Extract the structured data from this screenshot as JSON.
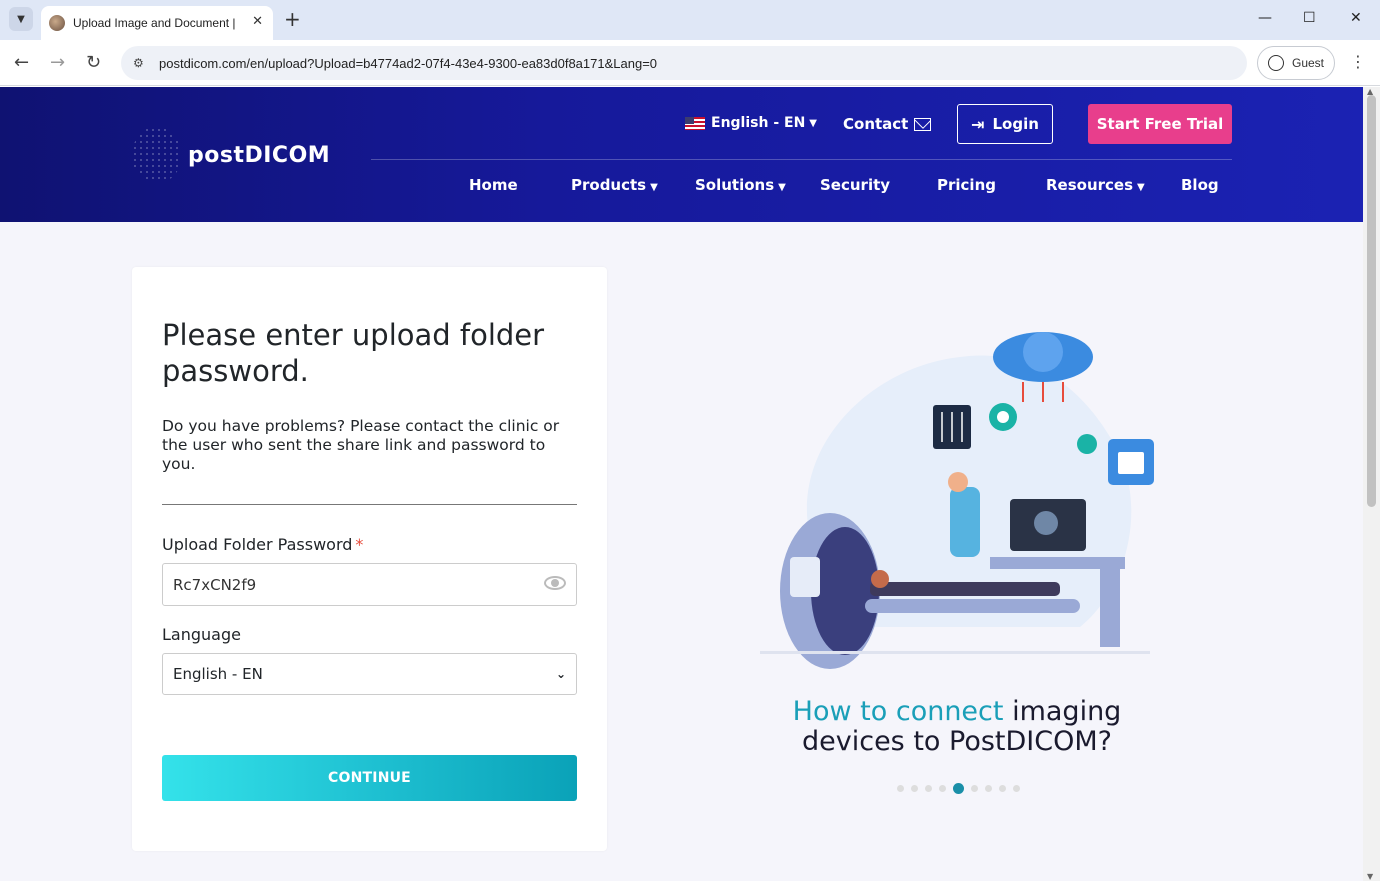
{
  "browser": {
    "tab_title": "Upload Image and Document |",
    "url": "postdicom.com/en/upload?Upload=b4774ad2-07f4-43e4-9300-ea83d0f8a171&Lang=0",
    "profile_label": "Guest"
  },
  "header": {
    "brand": "postDICOM",
    "language_label": "English - EN",
    "contact_label": "Contact",
    "login_label": "Login",
    "trial_label": "Start Free Trial",
    "nav": [
      "Home",
      "Products",
      "Solutions",
      "Security",
      "Pricing",
      "Resources",
      "Blog"
    ]
  },
  "form": {
    "title": "Please enter upload folder password.",
    "description": "Do you have problems? Please contact the clinic or the user who sent the share link and password to you.",
    "password_label": "Upload Folder Password",
    "required_mark": "*",
    "password_value": "Rc7xCN2f9",
    "language_label": "Language",
    "language_value": "English - EN",
    "continue_label": "CONTINUE"
  },
  "promo": {
    "highlight": "How to connect",
    "rest": "imaging devices to PostDICOM?",
    "slide_count": 9,
    "active_slide": 4
  },
  "colors": {
    "header_bg": "#1b22b3",
    "trial_button": "#e83e8c",
    "continue_button": "#1fc1d2",
    "promo_highlight": "#1a9fb8"
  }
}
